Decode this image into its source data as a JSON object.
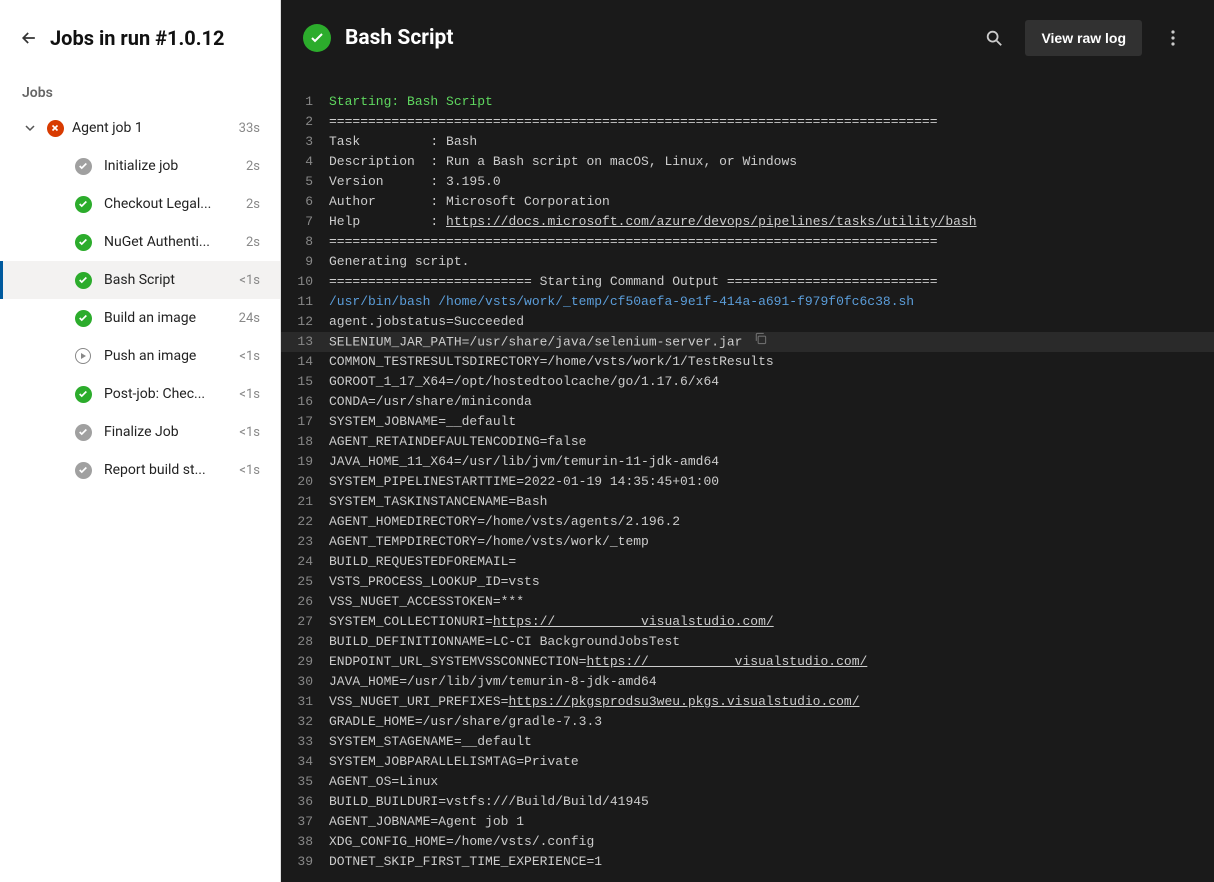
{
  "sidebar": {
    "title": "Jobs in run #1.0.12",
    "jobs_label": "Jobs",
    "job": {
      "name": "Agent job 1",
      "duration": "33s",
      "status": "fail"
    },
    "steps": [
      {
        "name": "Initialize job",
        "duration": "2s",
        "status": "gray",
        "selected": false
      },
      {
        "name": "Checkout Legal...",
        "duration": "2s",
        "status": "success",
        "selected": false
      },
      {
        "name": "NuGet Authenti...",
        "duration": "2s",
        "status": "success",
        "selected": false
      },
      {
        "name": "Bash Script",
        "duration": "<1s",
        "status": "success",
        "selected": true
      },
      {
        "name": "Build an image",
        "duration": "24s",
        "status": "success",
        "selected": false
      },
      {
        "name": "Push an image",
        "duration": "<1s",
        "status": "ring",
        "selected": false
      },
      {
        "name": "Post-job: Chec...",
        "duration": "<1s",
        "status": "success",
        "selected": false
      },
      {
        "name": "Finalize Job",
        "duration": "<1s",
        "status": "gray",
        "selected": false
      },
      {
        "name": "Report build st...",
        "duration": "<1s",
        "status": "gray",
        "selected": false
      }
    ]
  },
  "header": {
    "title": "Bash Script",
    "raw_log": "View raw log"
  },
  "log": [
    {
      "n": 1,
      "t": "Starting: Bash Script",
      "cls": "green"
    },
    {
      "n": 2,
      "t": "=============================================================================="
    },
    {
      "n": 3,
      "t": "Task         : Bash"
    },
    {
      "n": 4,
      "t": "Description  : Run a Bash script on macOS, Linux, or Windows"
    },
    {
      "n": 5,
      "t": "Version      : 3.195.0"
    },
    {
      "n": 6,
      "t": "Author       : Microsoft Corporation"
    },
    {
      "n": 7,
      "pre": "Help         : ",
      "link": "https://docs.microsoft.com/azure/devops/pipelines/tasks/utility/bash"
    },
    {
      "n": 8,
      "t": "=============================================================================="
    },
    {
      "n": 9,
      "t": "Generating script."
    },
    {
      "n": 10,
      "t": "========================== Starting Command Output ==========================="
    },
    {
      "n": 11,
      "cmd": "/usr/bin/bash /home/vsts/work/_temp/cf50aefa-9e1f-414a-a691-f979f0fc6c38.sh"
    },
    {
      "n": 12,
      "t": "agent.jobstatus=Succeeded"
    },
    {
      "n": 13,
      "t": "SELENIUM_JAR_PATH=/usr/share/java/selenium-server.jar",
      "hl": true,
      "copy": true
    },
    {
      "n": 14,
      "t": "COMMON_TESTRESULTSDIRECTORY=/home/vsts/work/1/TestResults"
    },
    {
      "n": 15,
      "t": "GOROOT_1_17_X64=/opt/hostedtoolcache/go/1.17.6/x64"
    },
    {
      "n": 16,
      "t": "CONDA=/usr/share/miniconda"
    },
    {
      "n": 17,
      "t": "SYSTEM_JOBNAME=__default"
    },
    {
      "n": 18,
      "t": "AGENT_RETAINDEFAULTENCODING=false"
    },
    {
      "n": 19,
      "t": "JAVA_HOME_11_X64=/usr/lib/jvm/temurin-11-jdk-amd64"
    },
    {
      "n": 20,
      "t": "SYSTEM_PIPELINESTARTTIME=2022-01-19 14:35:45+01:00"
    },
    {
      "n": 21,
      "t": "SYSTEM_TASKINSTANCENAME=Bash"
    },
    {
      "n": 22,
      "t": "AGENT_HOMEDIRECTORY=/home/vsts/agents/2.196.2"
    },
    {
      "n": 23,
      "t": "AGENT_TEMPDIRECTORY=/home/vsts/work/_temp"
    },
    {
      "n": 24,
      "t": "BUILD_REQUESTEDFOREMAIL="
    },
    {
      "n": 25,
      "t": "VSTS_PROCESS_LOOKUP_ID=vsts"
    },
    {
      "n": 26,
      "t": "VSS_NUGET_ACCESSTOKEN=***"
    },
    {
      "n": 27,
      "pre": "SYSTEM_COLLECTIONURI=",
      "link": "https://           visualstudio.com/"
    },
    {
      "n": 28,
      "t": "BUILD_DEFINITIONNAME=LC-CI BackgroundJobsTest"
    },
    {
      "n": 29,
      "pre": "ENDPOINT_URL_SYSTEMVSSCONNECTION=",
      "link": "https://           visualstudio.com/"
    },
    {
      "n": 30,
      "t": "JAVA_HOME=/usr/lib/jvm/temurin-8-jdk-amd64"
    },
    {
      "n": 31,
      "pre": "VSS_NUGET_URI_PREFIXES=",
      "link": "https://pkgsprodsu3weu.pkgs.visualstudio.com/"
    },
    {
      "n": 32,
      "t": "GRADLE_HOME=/usr/share/gradle-7.3.3"
    },
    {
      "n": 33,
      "t": "SYSTEM_STAGENAME=__default"
    },
    {
      "n": 34,
      "t": "SYSTEM_JOBPARALLELISMTAG=Private"
    },
    {
      "n": 35,
      "t": "AGENT_OS=Linux"
    },
    {
      "n": 36,
      "t": "BUILD_BUILDURI=vstfs:///Build/Build/41945"
    },
    {
      "n": 37,
      "t": "AGENT_JOBNAME=Agent job 1"
    },
    {
      "n": 38,
      "t": "XDG_CONFIG_HOME=/home/vsts/.config"
    },
    {
      "n": 39,
      "t": "DOTNET_SKIP_FIRST_TIME_EXPERIENCE=1"
    }
  ]
}
